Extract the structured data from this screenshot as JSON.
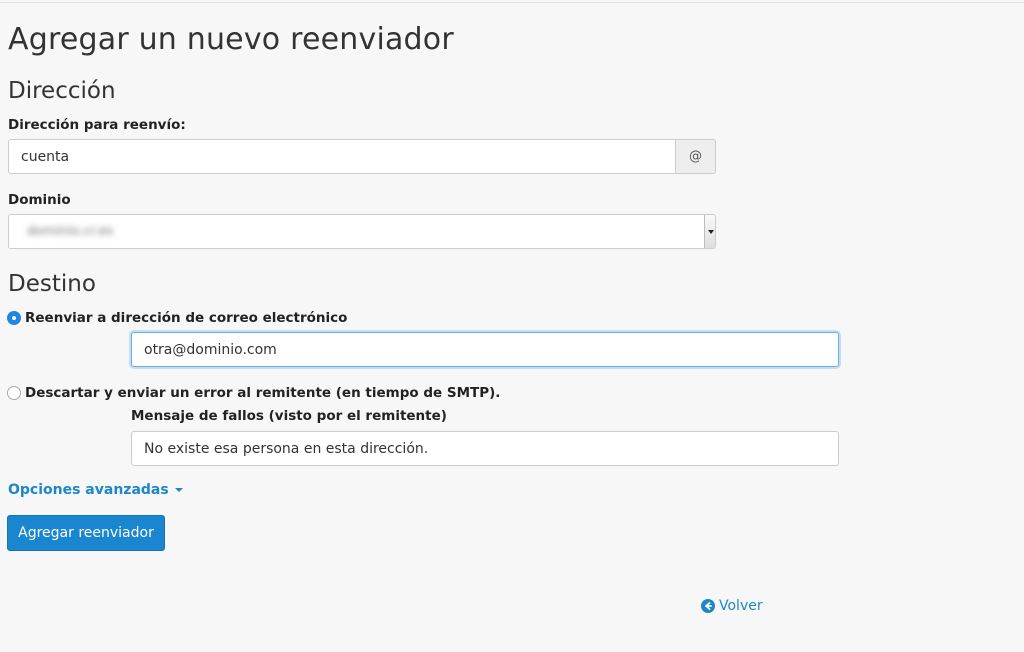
{
  "page": {
    "title": "Agregar un nuevo reenviador"
  },
  "address": {
    "section_title": "Dirección",
    "forward_label": "Dirección para reenvío:",
    "forward_value": "cuenta",
    "at_symbol": "@",
    "domain_label": "Dominio",
    "domain_value": "dominio.cr.es"
  },
  "destination": {
    "section_title": "Destino",
    "forward_option_label": "Reenviar a dirección de correo electrónico",
    "forward_option_selected": true,
    "forward_email_value": "otra@dominio.com",
    "discard_option_label": "Descartar y enviar un error al remitente (en tiempo de SMTP).",
    "discard_option_selected": false,
    "failure_message_label": "Mensaje de fallos (visto por el remitente)",
    "failure_message_value": "No existe esa persona en esta dirección."
  },
  "advanced": {
    "label": "Opciones avanzadas"
  },
  "actions": {
    "submit_label": "Agregar reenviador",
    "back_label": "Volver"
  },
  "colors": {
    "accent": "#1a86d0",
    "link": "#1e87c8",
    "background": "#f7f7f7"
  },
  "icons": {
    "back": "arrow-circle-left-icon",
    "advanced": "caret-down-icon"
  }
}
